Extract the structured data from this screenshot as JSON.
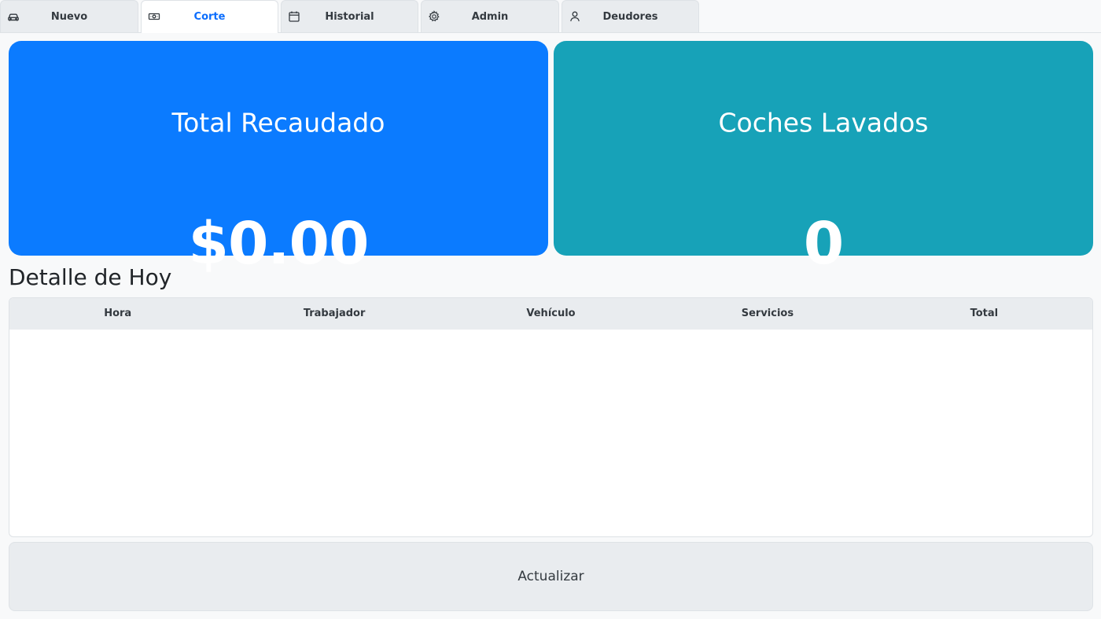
{
  "tabs": [
    {
      "label": "Nuevo",
      "icon": "car-icon"
    },
    {
      "label": "Corte",
      "icon": "cash-icon",
      "active": true
    },
    {
      "label": "Historial",
      "icon": "calendar-icon"
    },
    {
      "label": "Admin",
      "icon": "gear-icon"
    },
    {
      "label": "Deudores",
      "icon": "person-icon"
    }
  ],
  "stats": {
    "total": {
      "title": "Total Recaudado",
      "value": "$0.00",
      "color": "#0b7bff"
    },
    "cars": {
      "title": "Coches Lavados",
      "value": "0",
      "color": "#17a2b8"
    }
  },
  "detail": {
    "title": "Detalle de Hoy",
    "columns": [
      "Hora",
      "Trabajador",
      "Vehículo",
      "Servicios",
      "Total"
    ],
    "rows": []
  },
  "actions": {
    "refresh_label": "Actualizar"
  }
}
